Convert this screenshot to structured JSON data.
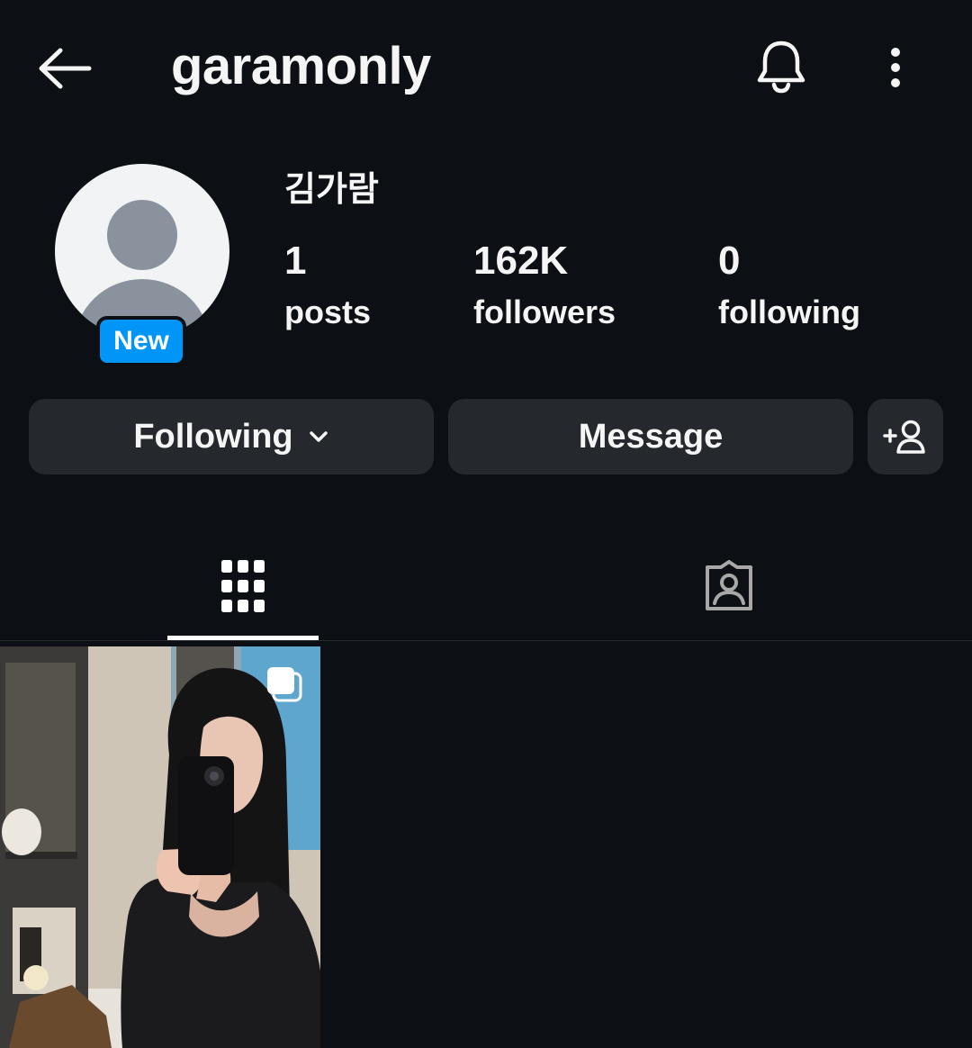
{
  "header": {
    "username": "garamonly"
  },
  "profile": {
    "full_name": "김가람",
    "badge": "New",
    "stats": {
      "posts": {
        "value": "1",
        "label": "posts"
      },
      "followers": {
        "value": "162K",
        "label": "followers"
      },
      "following": {
        "value": "0",
        "label": "following"
      }
    }
  },
  "actions": {
    "following_label": "Following",
    "message_label": "Message"
  },
  "icons": {
    "back": "arrow-left-icon",
    "notifications": "bell-icon",
    "more": "more-vertical-icon",
    "dropdown": "chevron-down-icon",
    "add_user": "add-person-icon",
    "grid": "grid-icon",
    "tagged": "tagged-person-icon",
    "multi_post": "carousel-icon"
  },
  "colors": {
    "background": "#0c1014",
    "button": "#25292e",
    "badge": "#0095f6",
    "text": "#f5f5f5",
    "inactive_icon": "#a8a8a8"
  }
}
